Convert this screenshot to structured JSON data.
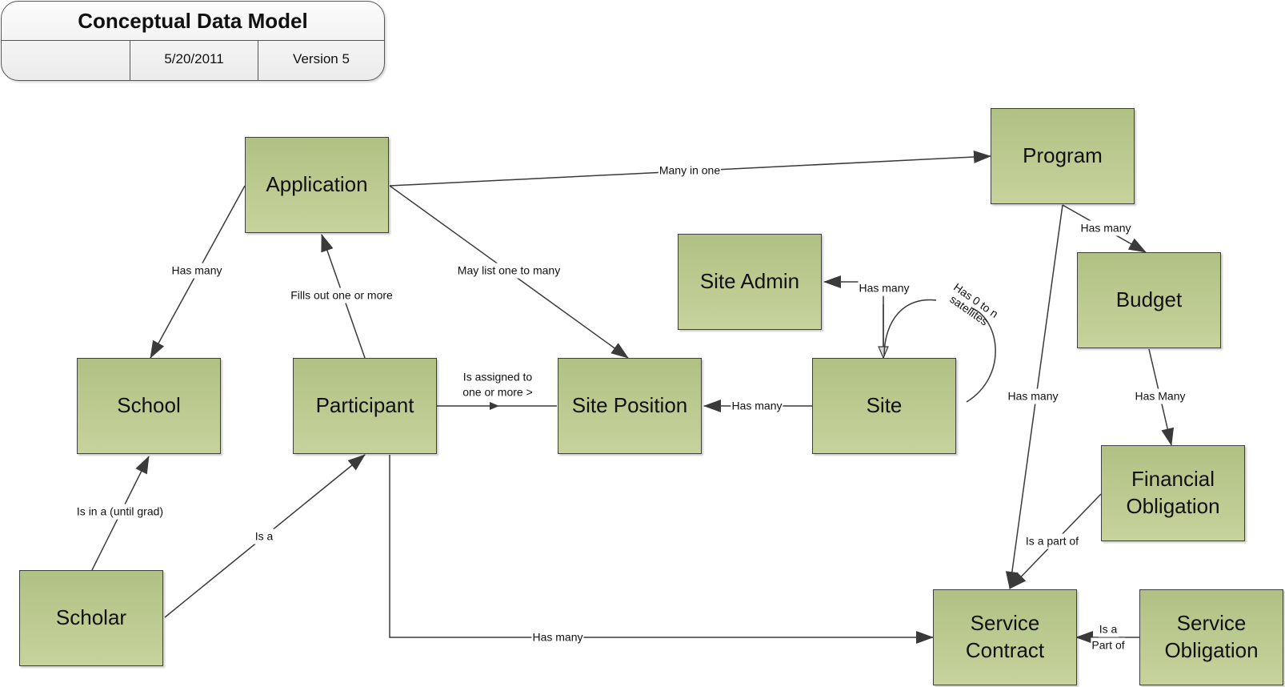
{
  "title_block": {
    "title": "Conceptual Data Model",
    "cell1": "",
    "date": "5/20/2011",
    "version": "Version 5"
  },
  "colors": {
    "entity_fill_top": "#b1c184",
    "entity_fill_bottom": "#c6d39c",
    "entity_border": "#3f3f3f",
    "line": "#3a3a3a"
  },
  "entities": {
    "application": "Application",
    "program": "Program",
    "site_admin": "Site Admin",
    "budget": "Budget",
    "school": "School",
    "participant": "Participant",
    "site_position": "Site Position",
    "site": "Site",
    "financial_obligation": "Financial Obligation",
    "scholar": "Scholar",
    "service_contract": "Service Contract",
    "service_obligation": "Service Obligation"
  },
  "relationships": {
    "application_program": "Many in one",
    "application_school": "Has many",
    "participant_application": "Fills out one or more",
    "application_site_position": "May list one to many",
    "site_site_admin": "Has many",
    "site_satellites": "Has 0 to n satellites",
    "participant_site_position_line1": "Is assigned to",
    "participant_site_position_line2": "one or more >",
    "site_site_position": "Has many",
    "program_budget": "Has many",
    "program_service_contract": "Has many",
    "budget_financial_obligation": "Has Many",
    "financial_obligation_service_contract": "Is a part of",
    "scholar_school": "Is in a (until grad)",
    "scholar_participant": "Is a",
    "participant_service_contract": "Has many",
    "service_obligation_service_contract_line1": "Is a",
    "service_obligation_service_contract_line2": "Part of"
  }
}
